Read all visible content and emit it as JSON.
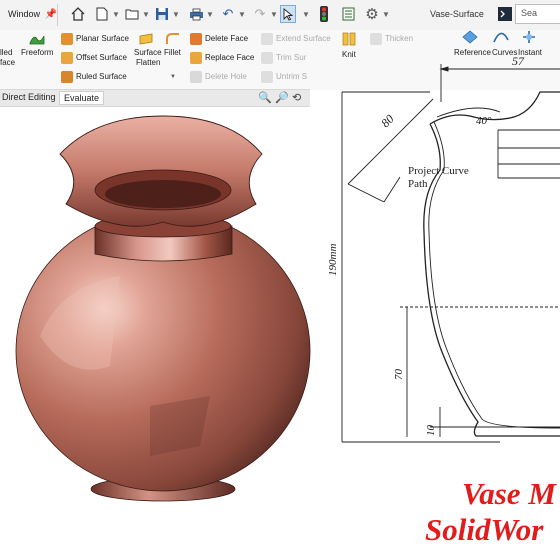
{
  "menu": {
    "window": "Window"
  },
  "window_title": "Vase-Surface",
  "search": {
    "placeholder": "Sea"
  },
  "ribbon": {
    "filled_surface": "lled",
    "filled_surface2": "face",
    "freeform": "Freeform",
    "planar_surface": "Planar Surface",
    "offset_surface": "Offset Surface",
    "ruled_surface": "Ruled Surface",
    "surface_flatten": "Surface",
    "surface_flatten2": "Flatten",
    "fillet": "Fillet",
    "delete_face": "Delete Face",
    "replace_face": "Replace Face",
    "delete_hole": "Delete Hole",
    "extend_surface": "Extend Surface",
    "trim_surface": "Trim Sur",
    "untrim_surface": "Untrim S",
    "knit": "Knit",
    "thicken": "Thicken",
    "reference": "Reference",
    "curves": "Curves",
    "instant": "Instant"
  },
  "tabs": {
    "direct_editing": "Direct Editing",
    "evaluate": "Evaluate"
  },
  "drawing": {
    "dim_top": "57",
    "dim_slant": "80",
    "dim_angle": "40°",
    "dim_height": "190mm",
    "dim_mid": "70",
    "dim_bottom": "10",
    "note_line1": "Project Curve",
    "note_line2": "Path"
  },
  "overlay": {
    "line1": "Vase M",
    "line2": "SolidWor"
  },
  "colors": {
    "accent_red": "#e21b1b",
    "vase_copper": "#c47a6a"
  }
}
